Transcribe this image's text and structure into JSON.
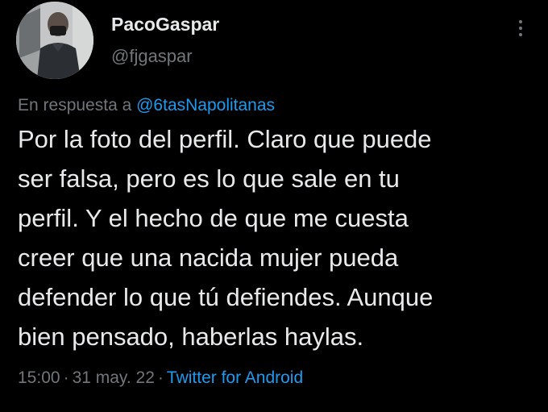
{
  "tweet": {
    "author": {
      "display_name": "PacoGaspar",
      "handle": "@fjgaspar",
      "avatar_icon": "profile-photo-man-with-mask"
    },
    "reply_prefix": "En respuesta a",
    "reply_to": "@6tasNapolitanas",
    "text": "Por la foto del perfil. Claro que puede\nser falsa, pero es lo que sale en tu\nperfil. Y el hecho de que me cuesta\ncreer que una nacida mujer pueda\ndefender lo que tú defiendes. Aunque\nbien pensado, haberlas haylas.",
    "time": "15:00",
    "date": "31 may. 22",
    "source": "Twitter for Android",
    "separator": "·",
    "more_icon": "more-vertical-icon"
  },
  "colors": {
    "background": "#000000",
    "primary_text": "#e7e9ea",
    "secondary_text": "#71767b",
    "link": "#1d9bf0"
  }
}
